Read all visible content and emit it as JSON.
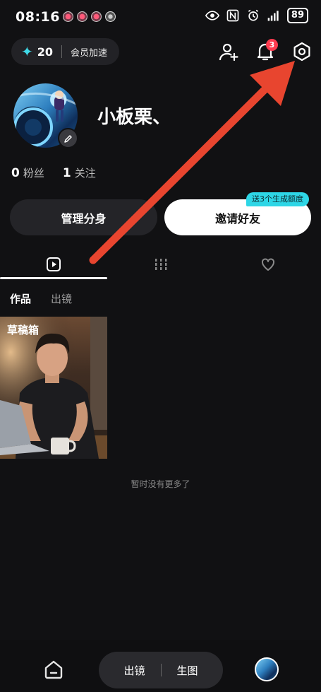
{
  "status_bar": {
    "time": "08:16",
    "battery": "89"
  },
  "header": {
    "credits": "20",
    "vip_label": "会员加速",
    "notification_count": "3"
  },
  "profile": {
    "username": "小板栗、",
    "followers_count": "0",
    "followers_label": "粉丝",
    "following_count": "1",
    "following_label": "关注"
  },
  "actions": {
    "manage_label": "管理分身",
    "invite_label": "邀请好友",
    "invite_tag": "送3个生成额度"
  },
  "tabs": {
    "active_index": 0
  },
  "subtabs": {
    "works": "作品",
    "cameo": "出镜"
  },
  "content": {
    "draft_label": "草稿箱",
    "empty_text": "暂时没有更多了"
  },
  "bottom_nav": {
    "cameo": "出镜",
    "generate": "生图"
  },
  "colors": {
    "accent": "#2ed6e6",
    "badge": "#ff3b4f",
    "arrow": "#e8452f"
  },
  "icons": [
    "sparkle-icon",
    "add-user-icon",
    "bell-icon",
    "settings-icon",
    "edit-icon",
    "play-icon",
    "grid-icon",
    "heart-icon",
    "home-icon"
  ]
}
